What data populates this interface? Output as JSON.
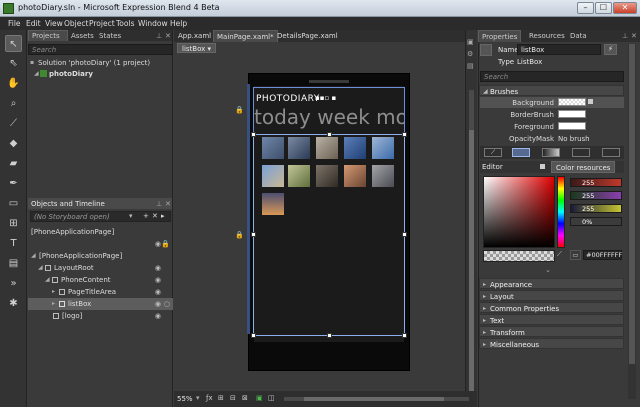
{
  "window": {
    "title": "photoDiary.sln - Microsoft Expression Blend 4 Beta",
    "minimize": "–",
    "maximize": "☐",
    "close": "✕"
  },
  "menu": [
    "File",
    "Edit",
    "View",
    "Object",
    "Project",
    "Tools",
    "Window",
    "Help"
  ],
  "projects_panel": {
    "tabs": [
      "Projects",
      "Assets",
      "States"
    ],
    "search_placeholder": "Search",
    "solution": "Solution 'photoDiary' (1 project)",
    "project": "photoDiary"
  },
  "objects_panel": {
    "title": "Objects and Timeline",
    "storyboard": "(No Storyboard open)",
    "root": "[PhoneApplicationPage]",
    "tree": [
      {
        "label": "[PhoneApplicationPage]",
        "indent": 1
      },
      {
        "label": "LayoutRoot",
        "indent": 2
      },
      {
        "label": "PhoneContent",
        "indent": 3
      },
      {
        "label": "PageTitleArea",
        "indent": 4
      },
      {
        "label": "listBox",
        "indent": 4,
        "selected": true
      },
      {
        "label": "[logo]",
        "indent": 3
      }
    ]
  },
  "document": {
    "tabs": [
      "App.xaml",
      "MainPage.xaml*",
      "DetailsPage.xaml"
    ],
    "breadcrumb": "listBox",
    "zoom": "55%",
    "phone_app_title": "PHOTODIARY",
    "phone_pivot": "today week mo"
  },
  "right_panel": {
    "tabs": [
      "Properties",
      "Resources",
      "Data"
    ],
    "name_label": "Name",
    "name_value": "listBox",
    "type_label": "Type",
    "type_value": "ListBox",
    "search_placeholder": "Search",
    "brushes_title": "Brushes",
    "brushes": [
      {
        "label": "Background",
        "value": ""
      },
      {
        "label": "BorderBrush",
        "value": ""
      },
      {
        "label": "Foreground",
        "value": ""
      },
      {
        "label": "OpacityMask",
        "value": "No brush"
      }
    ],
    "editor_label": "Editor",
    "color_resources": "Color resources",
    "channels": [
      {
        "label": "R",
        "value": "255",
        "color": "#c0392b"
      },
      {
        "label": "G",
        "value": "255",
        "color": "#3f9b2f"
      },
      {
        "label": "B",
        "value": "255",
        "color": "#3b5fc0"
      },
      {
        "label": "A",
        "value": "0%",
        "color": "#777777"
      }
    ],
    "hex_value": "#00FFFFFF",
    "categories": [
      "Appearance",
      "Layout",
      "Common Properties",
      "Text",
      "Transform",
      "Miscellaneous"
    ]
  }
}
